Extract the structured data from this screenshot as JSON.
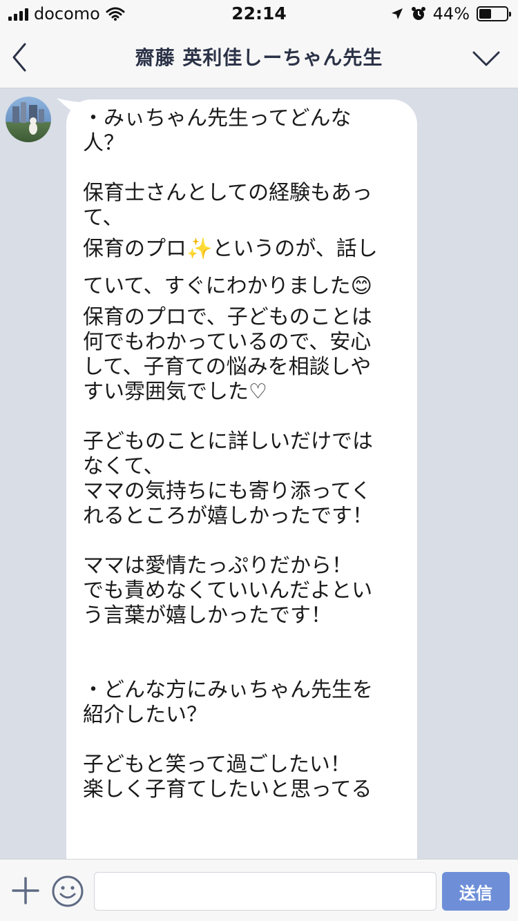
{
  "status_bar": {
    "carrier": "docomo",
    "time": "22:14",
    "battery": "44%",
    "battery_level": 0.44
  },
  "header": {
    "title": "齋藤 英利佳しーちゃん先生",
    "back_icon": "chevron-left-icon",
    "menu_icon": "chevron-down-icon"
  },
  "message": {
    "lines": [
      "・みぃちゃん先生ってどんな",
      "人？",
      "",
      "保育士さんとしての経験もあっ",
      "て、",
      "保育のプロ✨というのが、話し",
      "ていて、すぐにわかりました😊",
      "保育のプロで、子どものことは",
      "何でもわかっているので、安心",
      "して、子育ての悩みを相談しや",
      "すい雰囲気でした♡",
      "",
      "子どものことに詳しいだけでは",
      "なくて、",
      "ママの気持ちにも寄り添ってく",
      "れるところが嬉しかったです！",
      "",
      "ママは愛情たっぷりだから！",
      "でも責めなくていいんだよとい",
      "う言葉が嬉しかったです！",
      "",
      "",
      "・どんな方にみぃちゃん先生を",
      "紹介したい？",
      "",
      "子どもと笑って過ごしたい！",
      "楽しく子育てしたいと思ってる"
    ]
  },
  "input_bar": {
    "placeholder": "",
    "send_label": "送信",
    "plus_icon": "plus-icon",
    "emoji_icon": "smiley-icon"
  },
  "colors": {
    "chat_background": "#d8dde6",
    "bubble": "#ffffff",
    "send_button": "#6e8fd8",
    "header_title": "#2b3247"
  }
}
